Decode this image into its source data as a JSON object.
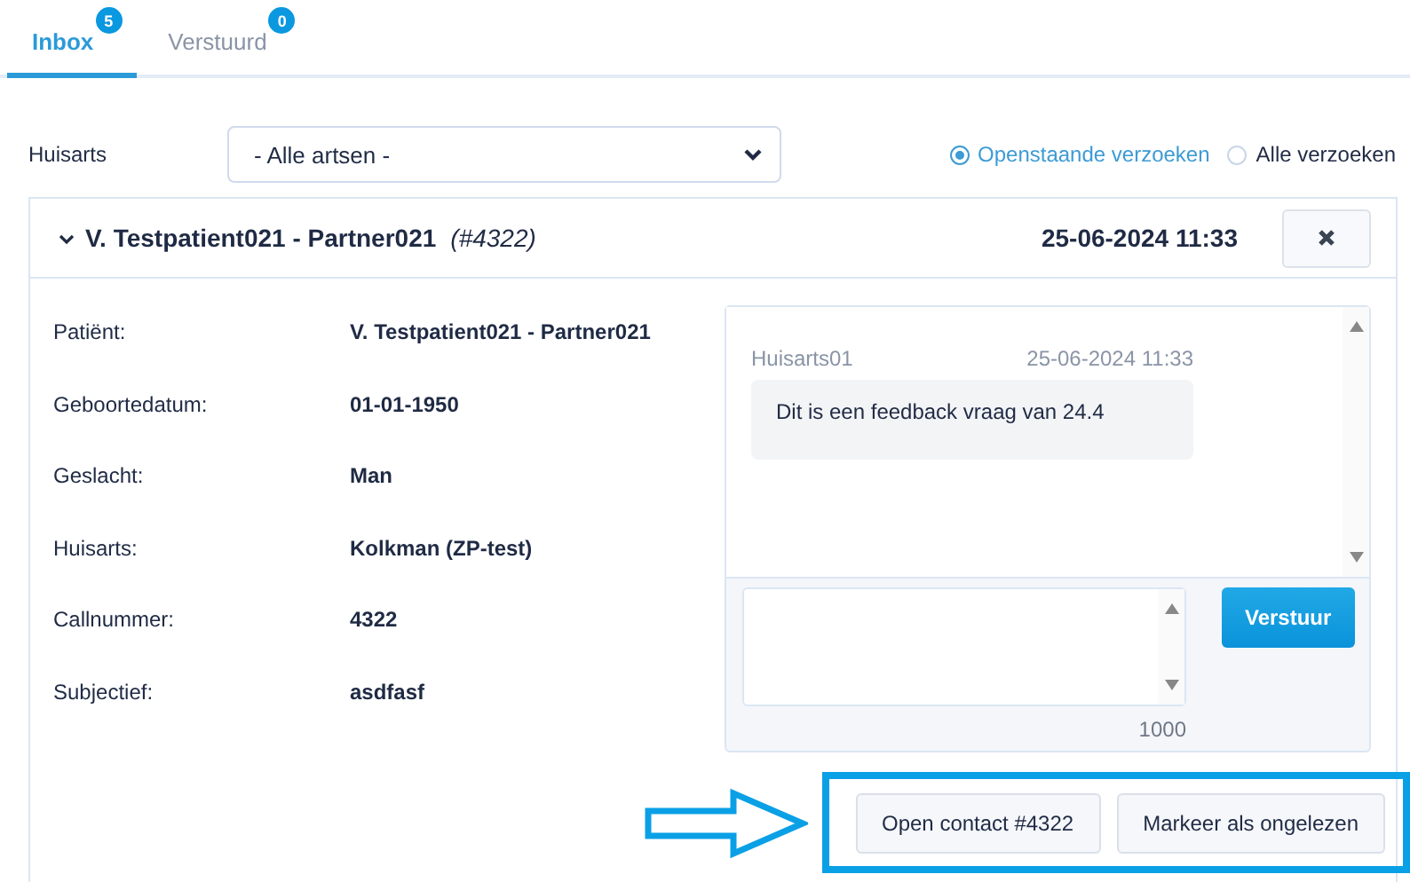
{
  "tabs": [
    {
      "label": "Inbox",
      "badge": "5",
      "selected": true
    },
    {
      "label": "Verstuurd",
      "badge": "0",
      "selected": false
    }
  ],
  "filter": {
    "label": "Huisarts",
    "select_value": "- Alle artsen -",
    "options": [
      {
        "label": "Openstaande verzoeken",
        "selected": true
      },
      {
        "label": "Alle verzoeken",
        "selected": false
      }
    ]
  },
  "request": {
    "title": "V. Testpatient021 - Partner021",
    "number": "(#4322)",
    "expanded": true,
    "date": "25-06-2024 11:33",
    "fields": [
      {
        "label": "Patiënt:",
        "value": "V. Testpatient021 - Partner021"
      },
      {
        "label": "Geboortedatum:",
        "value": "01-01-1950"
      },
      {
        "label": "Geslacht:",
        "value": "Man"
      },
      {
        "label": "Huisarts:",
        "value": "Kolkman (ZP-test)"
      },
      {
        "label": "Callnummer:",
        "value": "4322"
      },
      {
        "label": "Subjectief:",
        "value": "asdfasf"
      }
    ],
    "messages": [
      {
        "author": "Huisarts01",
        "time": "25-06-2024 11:33",
        "text": "Dit is een feedback vraag van 24.4"
      }
    ],
    "reply": {
      "counter": "1000",
      "send": "Verstuur"
    },
    "actions": [
      "Open contact #4322",
      "Markeer als ongelezen"
    ]
  }
}
